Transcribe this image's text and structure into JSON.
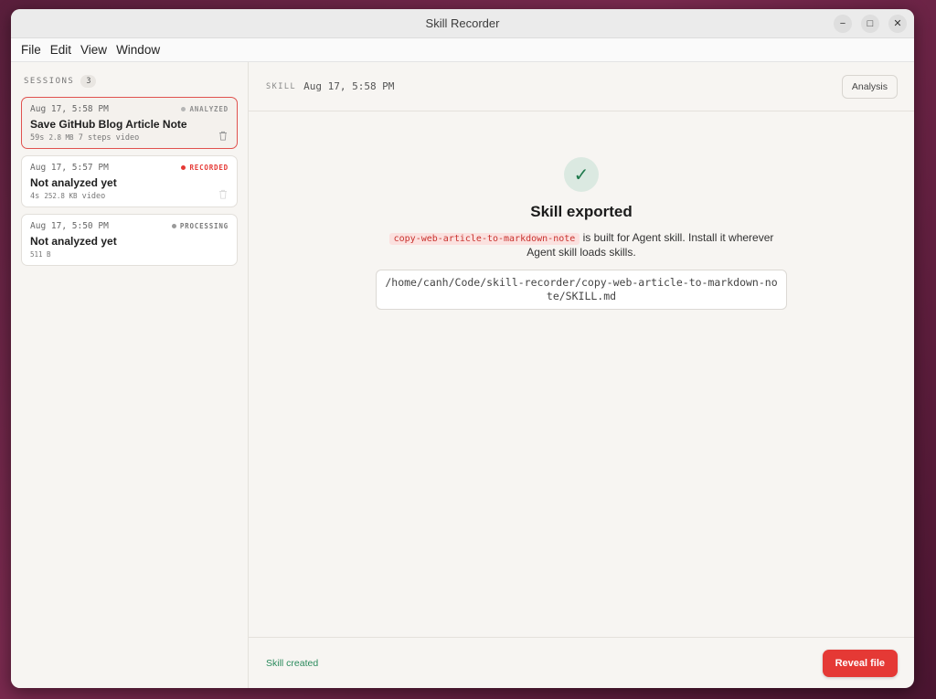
{
  "window": {
    "title": "Skill Recorder",
    "controls": {
      "minimize": "−",
      "maximize": "□",
      "close": "✕"
    }
  },
  "menu": [
    "File",
    "Edit",
    "View",
    "Window"
  ],
  "sidebar": {
    "label": "SESSIONS",
    "count": "3",
    "sessions": [
      {
        "date": "Aug 17, 5:58 PM",
        "status": "ANALYZED",
        "status_color": "#9a9a9a",
        "title": "Save GitHub Blog Article Note",
        "duration": "59s",
        "size": "2.8 MB",
        "steps": "7 steps",
        "type": "video",
        "selected": true
      },
      {
        "date": "Aug 17, 5:57 PM",
        "status": "RECORDED",
        "status_color": "#e53935",
        "title": "Not analyzed yet",
        "duration": "4s",
        "size": "252.8 KB",
        "type": "video",
        "selected": false
      },
      {
        "date": "Aug 17, 5:50 PM",
        "status": "PROCESSING",
        "status_color": "#8a8a8a",
        "title": "Not analyzed yet",
        "size": "511 B",
        "selected": false
      }
    ]
  },
  "main": {
    "header": {
      "label": "SKILL",
      "date": "Aug 17, 5:58 PM",
      "analysis_button": "Analysis"
    },
    "export": {
      "check": "✓",
      "title": "Skill exported",
      "skill_name": "copy-web-article-to-markdown-note",
      "desc_part1": " is built for Agent skill. Install it wherever",
      "desc_part2": "Agent skill loads skills.",
      "path": "/home/canh/Code/skill-recorder/copy-web-article-to-markdown-note/SKILL.md"
    },
    "footer": {
      "status": "Skill created",
      "reveal_button": "Reveal file"
    }
  },
  "colors": {
    "accent": "#e53935",
    "success": "#2a8a5c",
    "check_bg": "#dbe9e1"
  },
  "icons": {
    "trash": "trash-icon",
    "check": "checkmark-icon"
  }
}
